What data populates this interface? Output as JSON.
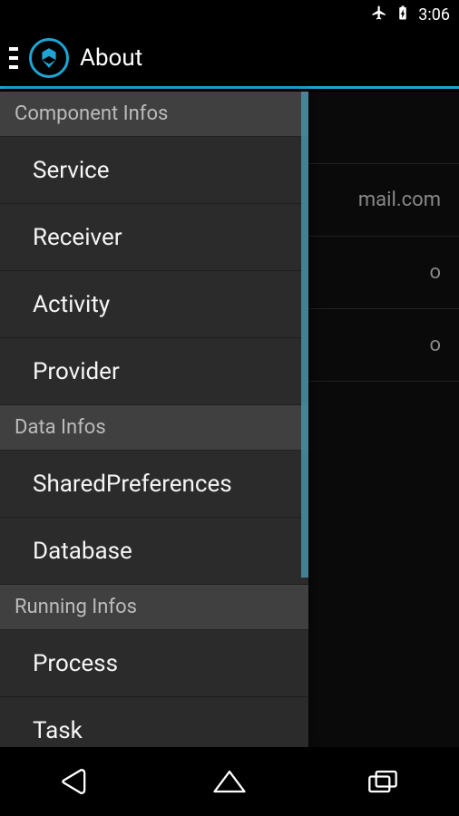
{
  "status": {
    "time": "3:06"
  },
  "actionBar": {
    "title": "About"
  },
  "drawer": {
    "sections": [
      {
        "header": "Component Infos",
        "items": [
          "Service",
          "Receiver",
          "Activity",
          "Provider"
        ]
      },
      {
        "header": "Data Infos",
        "items": [
          "SharedPreferences",
          "Database"
        ]
      },
      {
        "header": "Running Infos",
        "items": [
          "Process",
          "Task"
        ]
      }
    ]
  },
  "background": {
    "row1": "mail.com",
    "row2": "o",
    "row3": "o"
  }
}
